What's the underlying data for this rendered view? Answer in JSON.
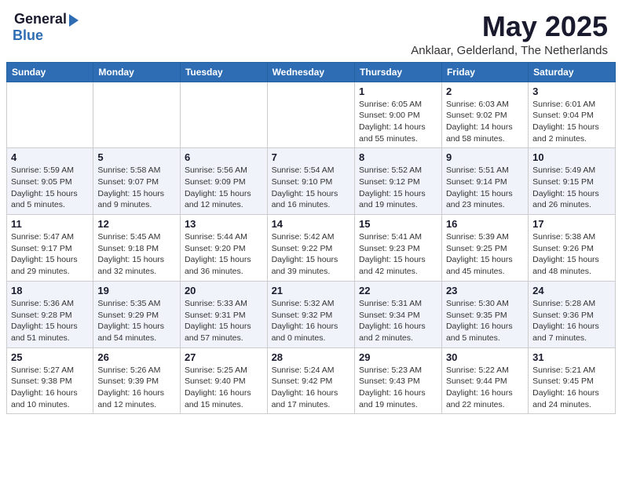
{
  "header": {
    "logo_general": "General",
    "logo_blue": "Blue",
    "month": "May 2025",
    "location": "Anklaar, Gelderland, The Netherlands"
  },
  "days_of_week": [
    "Sunday",
    "Monday",
    "Tuesday",
    "Wednesday",
    "Thursday",
    "Friday",
    "Saturday"
  ],
  "weeks": [
    [
      {
        "day": "",
        "info": ""
      },
      {
        "day": "",
        "info": ""
      },
      {
        "day": "",
        "info": ""
      },
      {
        "day": "",
        "info": ""
      },
      {
        "day": "1",
        "info": "Sunrise: 6:05 AM\nSunset: 9:00 PM\nDaylight: 14 hours\nand 55 minutes."
      },
      {
        "day": "2",
        "info": "Sunrise: 6:03 AM\nSunset: 9:02 PM\nDaylight: 14 hours\nand 58 minutes."
      },
      {
        "day": "3",
        "info": "Sunrise: 6:01 AM\nSunset: 9:04 PM\nDaylight: 15 hours\nand 2 minutes."
      }
    ],
    [
      {
        "day": "4",
        "info": "Sunrise: 5:59 AM\nSunset: 9:05 PM\nDaylight: 15 hours\nand 5 minutes."
      },
      {
        "day": "5",
        "info": "Sunrise: 5:58 AM\nSunset: 9:07 PM\nDaylight: 15 hours\nand 9 minutes."
      },
      {
        "day": "6",
        "info": "Sunrise: 5:56 AM\nSunset: 9:09 PM\nDaylight: 15 hours\nand 12 minutes."
      },
      {
        "day": "7",
        "info": "Sunrise: 5:54 AM\nSunset: 9:10 PM\nDaylight: 15 hours\nand 16 minutes."
      },
      {
        "day": "8",
        "info": "Sunrise: 5:52 AM\nSunset: 9:12 PM\nDaylight: 15 hours\nand 19 minutes."
      },
      {
        "day": "9",
        "info": "Sunrise: 5:51 AM\nSunset: 9:14 PM\nDaylight: 15 hours\nand 23 minutes."
      },
      {
        "day": "10",
        "info": "Sunrise: 5:49 AM\nSunset: 9:15 PM\nDaylight: 15 hours\nand 26 minutes."
      }
    ],
    [
      {
        "day": "11",
        "info": "Sunrise: 5:47 AM\nSunset: 9:17 PM\nDaylight: 15 hours\nand 29 minutes."
      },
      {
        "day": "12",
        "info": "Sunrise: 5:45 AM\nSunset: 9:18 PM\nDaylight: 15 hours\nand 32 minutes."
      },
      {
        "day": "13",
        "info": "Sunrise: 5:44 AM\nSunset: 9:20 PM\nDaylight: 15 hours\nand 36 minutes."
      },
      {
        "day": "14",
        "info": "Sunrise: 5:42 AM\nSunset: 9:22 PM\nDaylight: 15 hours\nand 39 minutes."
      },
      {
        "day": "15",
        "info": "Sunrise: 5:41 AM\nSunset: 9:23 PM\nDaylight: 15 hours\nand 42 minutes."
      },
      {
        "day": "16",
        "info": "Sunrise: 5:39 AM\nSunset: 9:25 PM\nDaylight: 15 hours\nand 45 minutes."
      },
      {
        "day": "17",
        "info": "Sunrise: 5:38 AM\nSunset: 9:26 PM\nDaylight: 15 hours\nand 48 minutes."
      }
    ],
    [
      {
        "day": "18",
        "info": "Sunrise: 5:36 AM\nSunset: 9:28 PM\nDaylight: 15 hours\nand 51 minutes."
      },
      {
        "day": "19",
        "info": "Sunrise: 5:35 AM\nSunset: 9:29 PM\nDaylight: 15 hours\nand 54 minutes."
      },
      {
        "day": "20",
        "info": "Sunrise: 5:33 AM\nSunset: 9:31 PM\nDaylight: 15 hours\nand 57 minutes."
      },
      {
        "day": "21",
        "info": "Sunrise: 5:32 AM\nSunset: 9:32 PM\nDaylight: 16 hours\nand 0 minutes."
      },
      {
        "day": "22",
        "info": "Sunrise: 5:31 AM\nSunset: 9:34 PM\nDaylight: 16 hours\nand 2 minutes."
      },
      {
        "day": "23",
        "info": "Sunrise: 5:30 AM\nSunset: 9:35 PM\nDaylight: 16 hours\nand 5 minutes."
      },
      {
        "day": "24",
        "info": "Sunrise: 5:28 AM\nSunset: 9:36 PM\nDaylight: 16 hours\nand 7 minutes."
      }
    ],
    [
      {
        "day": "25",
        "info": "Sunrise: 5:27 AM\nSunset: 9:38 PM\nDaylight: 16 hours\nand 10 minutes."
      },
      {
        "day": "26",
        "info": "Sunrise: 5:26 AM\nSunset: 9:39 PM\nDaylight: 16 hours\nand 12 minutes."
      },
      {
        "day": "27",
        "info": "Sunrise: 5:25 AM\nSunset: 9:40 PM\nDaylight: 16 hours\nand 15 minutes."
      },
      {
        "day": "28",
        "info": "Sunrise: 5:24 AM\nSunset: 9:42 PM\nDaylight: 16 hours\nand 17 minutes."
      },
      {
        "day": "29",
        "info": "Sunrise: 5:23 AM\nSunset: 9:43 PM\nDaylight: 16 hours\nand 19 minutes."
      },
      {
        "day": "30",
        "info": "Sunrise: 5:22 AM\nSunset: 9:44 PM\nDaylight: 16 hours\nand 22 minutes."
      },
      {
        "day": "31",
        "info": "Sunrise: 5:21 AM\nSunset: 9:45 PM\nDaylight: 16 hours\nand 24 minutes."
      }
    ]
  ]
}
